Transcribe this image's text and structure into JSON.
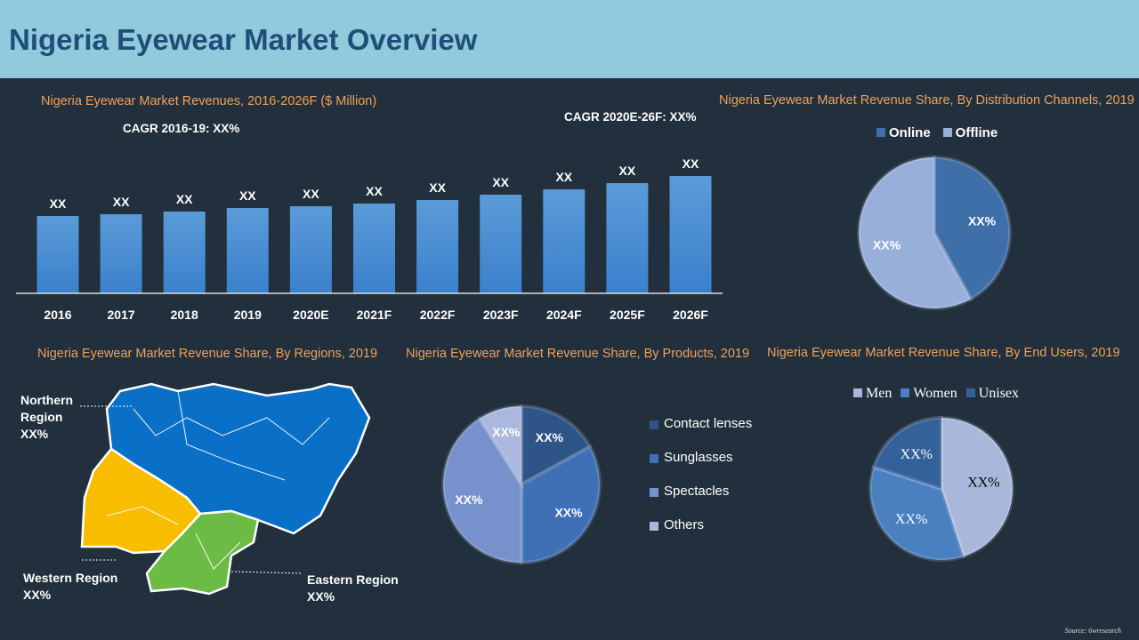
{
  "header": {
    "title": "Nigeria Eyewear Market Overview"
  },
  "source": "Source: 6wresearch",
  "chart_data": [
    {
      "type": "bar",
      "title": "Nigeria Eyewear Market Revenues, 2016-2026F ($ Million)",
      "categories": [
        "2016",
        "2017",
        "2018",
        "2019",
        "2020E",
        "2021F",
        "2022F",
        "2023F",
        "2024F",
        "2025F",
        "2026F"
      ],
      "values": [
        87,
        89,
        92,
        96,
        98,
        101,
        105,
        111,
        117,
        124,
        132
      ],
      "data_labels": [
        "XX",
        "XX",
        "XX",
        "XX",
        "XX",
        "XX",
        "XX",
        "XX",
        "XX",
        "XX",
        "XX"
      ],
      "annotations": [
        "CAGR 2016-19: XX%",
        "CAGR 2020E-26F: XX%"
      ],
      "color": "#4a8fd4"
    },
    {
      "type": "pie",
      "title": "Nigeria Eyewear Market Revenue Share, By Distribution Channels, 2019",
      "labels": [
        "Online",
        "Offline"
      ],
      "values": [
        42,
        58
      ],
      "data_labels": [
        "XX%",
        "XX%"
      ],
      "colors": [
        "#3f6fa8",
        "#98aedb"
      ],
      "legend": "top"
    },
    {
      "type": "pie",
      "title": "Nigeria Eyewear Market Revenue Share, By Products, 2019",
      "labels": [
        "Contact lenses",
        "Sunglasses",
        "Spectacles",
        "Others"
      ],
      "values": [
        17,
        33,
        41,
        9
      ],
      "data_labels": [
        "XX%",
        "XX%",
        "XX%",
        "XX%"
      ],
      "colors": [
        "#2f5488",
        "#3f6fb5",
        "#7791cc",
        "#a9b8dc"
      ],
      "legend": "right"
    },
    {
      "type": "pie",
      "title": "Nigeria Eyewear Market Revenue Share, By End Users, 2019",
      "labels": [
        "Men",
        "Women",
        "Unisex"
      ],
      "values": [
        45,
        35,
        20
      ],
      "data_labels": [
        "XX%",
        "XX%",
        "XX%"
      ],
      "colors": [
        "#a9b8da",
        "#4a7fc0",
        "#35619a"
      ],
      "legend": "top"
    }
  ],
  "regions": {
    "title": "Nigeria Eyewear Market Revenue Share, By Regions, 2019",
    "northern": {
      "name": "Northern\nRegion",
      "line1": "Northern",
      "line2": "Region",
      "value": "XX%",
      "color": "#0a6fc7"
    },
    "western": {
      "name": "Western Region",
      "value": "XX%",
      "color": "#f9bd00"
    },
    "eastern": {
      "name": "Eastern Region",
      "value": "XX%",
      "color": "#6cbb45"
    }
  }
}
